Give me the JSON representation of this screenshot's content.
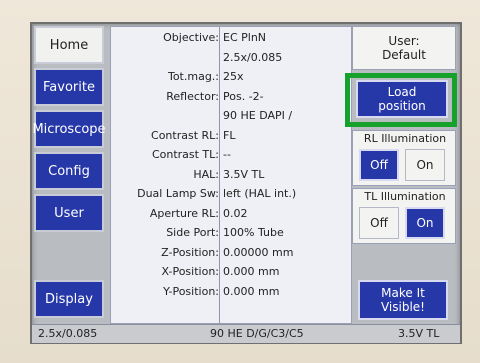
{
  "nav": {
    "home": "Home",
    "favorite": "Favorite",
    "microscope": "Microscope",
    "config": "Config",
    "user": "User",
    "display": "Display"
  },
  "info": {
    "rows": [
      {
        "label": "Objective:",
        "value": "EC PlnN"
      },
      {
        "label": "",
        "value": "2.5x/0.085"
      },
      {
        "label": "Tot.mag.:",
        "value": "25x"
      },
      {
        "label": "Reflector:",
        "value": "Pos. -2-"
      },
      {
        "label": "",
        "value": "90 HE DAPI /"
      },
      {
        "label": "Contrast RL:",
        "value": "FL"
      },
      {
        "label": "Contrast TL:",
        "value": "--"
      },
      {
        "label": "HAL:",
        "value": "3.5V    TL"
      },
      {
        "label": "Dual Lamp Sw:",
        "value": "left (HAL int.)"
      },
      {
        "label": "Aperture RL:",
        "value": "0.02"
      },
      {
        "label": "Side Port:",
        "value": "100% Tube"
      },
      {
        "label": "Z-Position:",
        "value": "0.00000 mm"
      },
      {
        "label": "X-Position:",
        "value": "0.000 mm"
      },
      {
        "label": "Y-Position:",
        "value": "0.000 mm"
      }
    ]
  },
  "right": {
    "user_line1": "User:",
    "user_line2": "Default",
    "load_line1": "Load",
    "load_line2": "position",
    "rl_label": "RL Illumination",
    "rl_off": "Off",
    "rl_on": "On",
    "tl_label": "TL Illumination",
    "tl_off": "Off",
    "tl_on": "On",
    "make_line1": "Make It",
    "make_line2": "Visible!"
  },
  "status": {
    "left": "2.5x/0.085",
    "middle": "90 HE D/G/C3/C5",
    "right": "3.5V TL"
  },
  "colors": {
    "accent_blue": "#2637a8",
    "highlight_green": "#16a12d"
  }
}
